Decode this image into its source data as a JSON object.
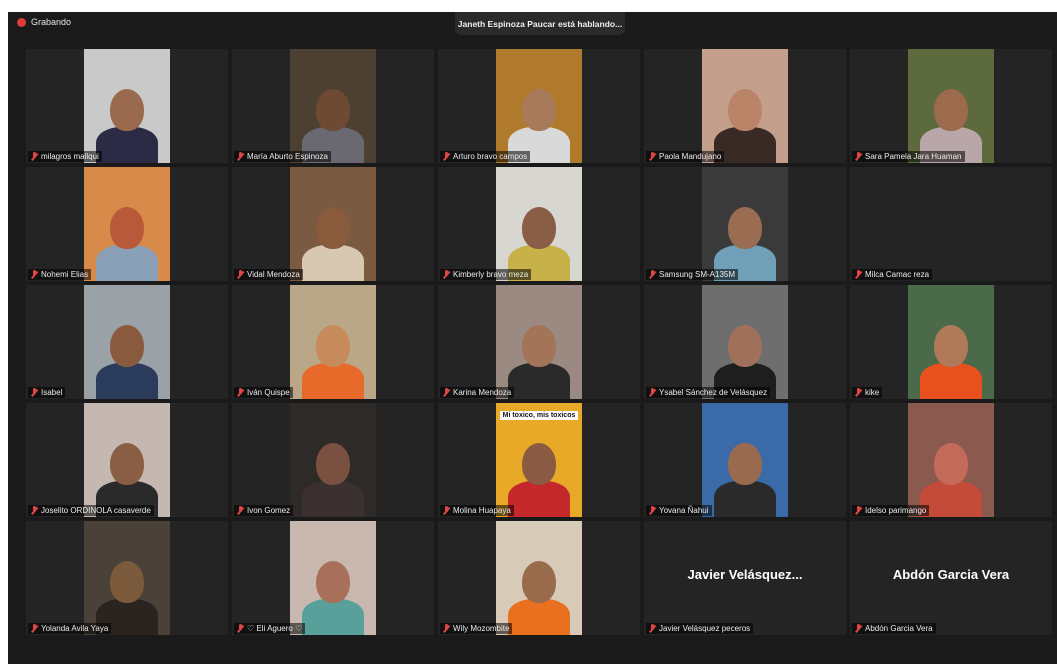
{
  "recording": {
    "label": "Grabando",
    "color": "#e03b3b"
  },
  "speaker_banner": "Janeth Espinoza Paucar está hablando...",
  "participants": [
    {
      "name": "milagros mallqui",
      "bg": "#c9c9c9",
      "skin": "#9a6a4e",
      "cloth": "#2b2b46"
    },
    {
      "name": "María Aburto Espinoza",
      "bg": "#4b4032",
      "skin": "#6e4a32",
      "cloth": "#6a6870"
    },
    {
      "name": "Arturo bravo campos",
      "bg": "#b07a2c",
      "skin": "#a77a5a",
      "cloth": "#d9d9d9"
    },
    {
      "name": "Paola Mandujano",
      "bg": "#c4a08c",
      "skin": "#b98468",
      "cloth": "#3a2a26"
    },
    {
      "name": "Sara Pamela Jara Huaman",
      "bg": "#5d6a3e",
      "skin": "#9c6a4c",
      "cloth": "#b8a6a8"
    },
    {
      "name": "Nohemi Elias",
      "bg": "#d88a4a",
      "skin": "#b85a3a",
      "cloth": "#8aa0b6"
    },
    {
      "name": "Vidal Mendoza",
      "bg": "#7a5a40",
      "skin": "#8a5a3c",
      "cloth": "#d8c8b2"
    },
    {
      "name": "Kimberly bravo meza",
      "bg": "#d8d6d0",
      "skin": "#8a5e46",
      "cloth": "#c7b24a"
    },
    {
      "name": "Samsung SM-A135M",
      "bg": "#3a3a3a",
      "skin": "#9a6c52",
      "cloth": "#6fa0b8"
    },
    {
      "name": "Milca Camac reza",
      "bg": "#242424",
      "skin": "",
      "cloth": ""
    },
    {
      "name": "Isabel",
      "bg": "#9aa2a8",
      "skin": "#8a5a3e",
      "cloth": "#2b3b5c"
    },
    {
      "name": "Iván Quispe",
      "bg": "#b9a788",
      "skin": "#c78a5a",
      "cloth": "#e86a2a"
    },
    {
      "name": "Karina Mendoza",
      "bg": "#9a8a82",
      "skin": "#a37458",
      "cloth": "#2a2a2a"
    },
    {
      "name": "Ysabel Sánchez de Velásquez",
      "bg": "#6e6e6e",
      "skin": "#a0705a",
      "cloth": "#1e1e1e"
    },
    {
      "name": "kike",
      "bg": "#4a6a4a",
      "skin": "#b07a5a",
      "cloth": "#e8501e"
    },
    {
      "name": "Joselito ORDINOLA casaverde",
      "bg": "#c4b8b0",
      "skin": "#8a5e44",
      "cloth": "#2a2a2a"
    },
    {
      "name": "Ivon Gomez",
      "bg": "#2e2a28",
      "skin": "#7a5040",
      "cloth": "#3a3030"
    },
    {
      "name": "Molina Huapaya",
      "bg": "#e8a828",
      "skin": "#8a5a42",
      "cloth": "#c4282a",
      "overlay": "Mi toxico, mis toxicos"
    },
    {
      "name": "Yovana Ñahui",
      "bg": "#3a6aa8",
      "skin": "#9a6a4e",
      "cloth": "#2a2a2a"
    },
    {
      "name": "Idelso parimango",
      "bg": "#8a5a4e",
      "skin": "#c46a5a",
      "cloth": "#c44a3a"
    },
    {
      "name": "Yolanda Avila Yaya",
      "bg": "#4a4238",
      "skin": "#7a5a3a",
      "cloth": "#2a2420"
    },
    {
      "name": "♡ Eli Aguero ♡",
      "bg": "#c8b8b0",
      "skin": "#a8705a",
      "cloth": "#5aa09a"
    },
    {
      "name": "Wily Mozombite",
      "bg": "#d8cab8",
      "skin": "#9a6a4c",
      "cloth": "#e8701e"
    },
    {
      "name": "Javier Velásquez peceros",
      "bg": "",
      "skin": "",
      "cloth": "",
      "display_name": "Javier Velásquez..."
    },
    {
      "name": "Abdón Garcia Vera",
      "bg": "",
      "skin": "",
      "cloth": "",
      "display_name": "Abdón Garcia Vera"
    }
  ]
}
